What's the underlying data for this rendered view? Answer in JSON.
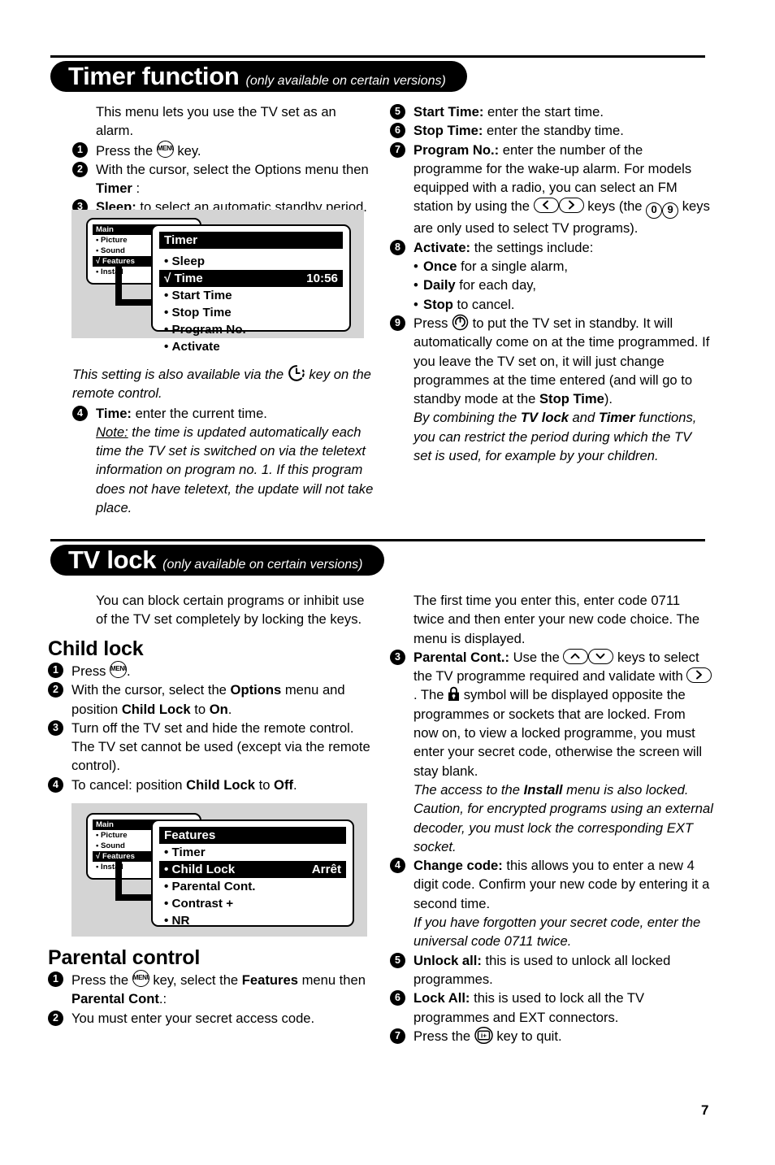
{
  "page": {
    "number": "7"
  },
  "sections": [
    {
      "id": "timer",
      "title": "Timer function",
      "subtitle": "(only available on certain versions)"
    },
    {
      "id": "tvlock",
      "title": "TV lock",
      "subtitle": "(only available on certain versions)"
    }
  ],
  "timer": {
    "intro": "This menu lets you use the TV set as an alarm.",
    "steps": [
      {
        "num": "1",
        "text_before": "Press the ",
        "icon": "menu-key-icon",
        "text_after": " key."
      },
      {
        "num": "2",
        "line1": "With the cursor, select the Options menu then",
        "line2_bold": "Timer",
        "line2_after": " :"
      },
      {
        "num": "3",
        "label": "Sleep:",
        "text": " to select an automatic standby period."
      }
    ],
    "figure": {
      "back_menu": {
        "title": "Main",
        "items": [
          "Picture",
          "Sound",
          "Features",
          "Install"
        ],
        "checked_item": "Features"
      },
      "front_menu": {
        "title": "Timer",
        "items": [
          {
            "label": "Sleep",
            "value": "",
            "highlighted": false,
            "checked": false
          },
          {
            "label": "Time",
            "value": "10:56",
            "highlighted": true,
            "checked": true
          },
          {
            "label": "Start Time",
            "value": "",
            "highlighted": false,
            "checked": false
          },
          {
            "label": "Stop Time",
            "value": "",
            "highlighted": false,
            "checked": false
          },
          {
            "label": "Program No.",
            "value": "",
            "highlighted": false,
            "checked": false
          },
          {
            "label": "Activate",
            "value": "",
            "highlighted": false,
            "checked": false
          }
        ]
      }
    },
    "note_remote": {
      "before": "This setting is also available via the ",
      "icon": "clock-key-icon",
      "after": " key on the remote control."
    },
    "step4": {
      "num": "4",
      "label": "Time:",
      "text": " enter the current time.",
      "note_label": "Note:",
      "note_text": " the time is updated automatically each time the TV set is switched on via the teletext information on program no. 1. If this program does not have teletext, the update will not take place."
    },
    "right_steps": [
      {
        "num": "5",
        "label": "Start Time:",
        "text": " enter the start time."
      },
      {
        "num": "6",
        "label": "Stop Time:",
        "text": " enter the standby time."
      },
      {
        "num": "7",
        "label": "Program No.:",
        "text_1": " enter the number of the programme for the wake-up alarm. For models equipped with a radio, you can select an FM station by using the ",
        "icon_left": "cursor-left-key-icon",
        "icon_right": "cursor-right-key-icon",
        "text_2": " keys (the ",
        "icon_0": "digit-0-key-icon",
        "icon_9": "digit-9-key-icon",
        "text_3": " keys are only used to select TV programs)."
      },
      {
        "num": "8",
        "label": "Activate:",
        "text": " the settings include:",
        "bullets": [
          {
            "bold": "Once",
            "rest": " for a single alarm,"
          },
          {
            "bold": "Daily",
            "rest": " for each day,"
          },
          {
            "bold": "Stop",
            "rest": " to cancel."
          }
        ]
      },
      {
        "num": "9",
        "text_before": "Press ",
        "icon": "standby-power-key-icon",
        "text_after_1": " to put the TV set in standby. It will automatically come on at the time programmed. If you leave the TV set on, it will just change programmes at the time entered (and will go to standby mode at the ",
        "bold_1": "Stop Time",
        "text_after_2": ").",
        "italic_1": "By combining the ",
        "italic_bold_1": "TV lock",
        "italic_2": " and ",
        "italic_bold_2": "Timer",
        "italic_3": " functions, you can restrict the period during which the TV set is used, for example by your children."
      }
    ]
  },
  "tvlock": {
    "intro": "You can block certain programs or inhibit use of the TV set completely by locking the keys.",
    "child_lock": {
      "heading": "Child lock",
      "steps": [
        {
          "num": "1",
          "text_before": "Press ",
          "icon": "menu-key-icon",
          "text_after": "."
        },
        {
          "num": "2",
          "t1": "With the cursor, select the ",
          "b1": "Options",
          "t2": " menu and position ",
          "b2": "Child Lock",
          "t3": " to ",
          "b3": "On",
          "t4": "."
        },
        {
          "num": "3",
          "text": "Turn off the TV set and hide the remote control. The TV set cannot be used (except via the remote control)."
        },
        {
          "num": "4",
          "t1": "To cancel: position ",
          "b1": "Child Lock",
          "t2": " to ",
          "b2": "Off",
          "t3": "."
        }
      ]
    },
    "figure": {
      "back_menu": {
        "title": "Main",
        "items": [
          "Picture",
          "Sound",
          "Features",
          "Install"
        ],
        "checked_item": "Features"
      },
      "front_menu": {
        "title": "Features",
        "items": [
          {
            "label": "Timer",
            "value": "",
            "highlighted": false
          },
          {
            "label": "Child Lock",
            "value": "Arrêt",
            "highlighted": true
          },
          {
            "label": "Parental Cont.",
            "value": "",
            "highlighted": false
          },
          {
            "label": "Contrast +",
            "value": "",
            "highlighted": false
          },
          {
            "label": "NR",
            "value": "",
            "highlighted": false
          }
        ]
      }
    },
    "parental_control": {
      "heading": "Parental control",
      "steps": [
        {
          "num": "1",
          "t1": "Press the ",
          "icon": "menu-key-icon",
          "t2": " key, select the ",
          "b1": "Features",
          "t3": " menu then ",
          "b2": "Parental Cont",
          "t4": ".:"
        },
        {
          "num": "2",
          "text": "You must enter your secret access code."
        }
      ]
    },
    "right": {
      "intro": "The first time you enter this, enter code 0711 twice and then enter your new code choice. The menu is displayed.",
      "steps": [
        {
          "num": "3",
          "label": "Parental Cont.:",
          "t1": " Use the ",
          "icon_up": "cursor-up-key-icon",
          "icon_down": "cursor-down-key-icon",
          "t2": " keys to select the TV programme required and validate with ",
          "icon_right": "cursor-right-key-icon",
          "t3": ". The ",
          "icon_lock": "padlock-icon",
          "t4": " symbol will be displayed opposite the programmes or sockets that are locked. From now on, to view a locked programme, you must enter your secret code, otherwise the screen will stay blank.",
          "italic_1": "The access to the ",
          "italic_bold": "Install",
          "italic_2": " menu is also locked. Caution, for encrypted programs using an external decoder, you must lock the corresponding EXT socket."
        },
        {
          "num": "4",
          "label": "Change code:",
          "text": " this allows you to enter a new 4 digit code. Confirm your new code by entering it a second time.",
          "italic": "If you have forgotten your secret code, enter the universal code 0711 twice."
        },
        {
          "num": "5",
          "label": "Unlock all:",
          "text": " this is used to unlock all locked programmes."
        },
        {
          "num": "6",
          "label": "Lock All:",
          "text": " this is used to lock all the TV programmes and EXT connectors."
        },
        {
          "num": "7",
          "text_before": "Press the ",
          "icon": "quit-key-icon",
          "text_after": " key to quit."
        }
      ]
    }
  }
}
